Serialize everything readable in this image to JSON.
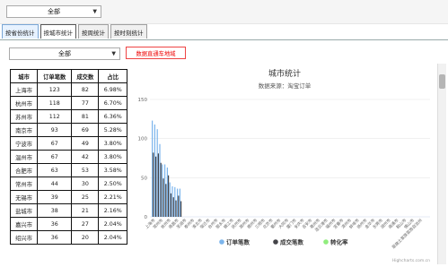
{
  "top_select": {
    "value": "全部"
  },
  "tabs": [
    {
      "label": "按省份统计",
      "state": "active"
    },
    {
      "label": "按城市统计",
      "state": "selected"
    },
    {
      "label": "按周统计",
      "state": "normal"
    },
    {
      "label": "按时刻统计",
      "state": "normal"
    }
  ],
  "sub_select": {
    "value": "全部"
  },
  "red_button": {
    "label": "数据直通车地域"
  },
  "table": {
    "headers": [
      "城市",
      "订单笔数",
      "成交数",
      "占比"
    ],
    "rows": [
      [
        "上海市",
        "123",
        "82",
        "6.98%"
      ],
      [
        "杭州市",
        "118",
        "77",
        "6.70%"
      ],
      [
        "苏州市",
        "112",
        "81",
        "6.36%"
      ],
      [
        "南京市",
        "93",
        "69",
        "5.28%"
      ],
      [
        "宁波市",
        "67",
        "49",
        "3.80%"
      ],
      [
        "温州市",
        "67",
        "42",
        "3.80%"
      ],
      [
        "合肥市",
        "63",
        "53",
        "3.58%"
      ],
      [
        "常州市",
        "44",
        "30",
        "2.50%"
      ],
      [
        "无锡市",
        "39",
        "25",
        "2.21%"
      ],
      [
        "盐城市",
        "38",
        "21",
        "2.16%"
      ],
      [
        "嘉兴市",
        "36",
        "27",
        "2.04%"
      ],
      [
        "绍兴市",
        "36",
        "20",
        "2.04%"
      ]
    ]
  },
  "chart_data": {
    "type": "bar",
    "title": "城市统计",
    "subtitle": "数据来源：淘宝订单",
    "ylim": [
      0,
      150
    ],
    "yticks": [
      0,
      50,
      100,
      150
    ],
    "grid": true,
    "legend_position": "bottom",
    "categories": [
      "上海市",
      "杭州市",
      "苏州市",
      "南京市",
      "宁波市",
      "温州市",
      "合肥市",
      "常州市",
      "无锡市",
      "盐城市",
      "嘉兴市",
      "绍兴市"
    ],
    "x_tick_labels": [
      "上海市",
      "常州市",
      "徐州市",
      "南昌市",
      "芜湖市",
      "泰州市",
      "淮北市",
      "宿迁市",
      "台州市",
      "丽水市",
      "镇江市",
      "抚州市",
      "滁州市",
      "德州市",
      "三明市",
      "北京市",
      "衢州市",
      "大同市",
      "厦门市",
      "安庆市",
      "吉安市",
      "亳州市",
      "连云港市",
      "福州市",
      "宜春市",
      "漳州市",
      "蚌埠市",
      "扬州市",
      "金华市",
      "东莞市",
      "湖州市",
      "南通市",
      "鞍山市",
      "佛山市",
      "恩施土家族苗族自治州"
    ],
    "series": [
      {
        "name": "订单笔数",
        "color": "#7cb5ec",
        "values": [
          123,
          118,
          112,
          93,
          67,
          67,
          63,
          44,
          39,
          38,
          36,
          36
        ]
      },
      {
        "name": "成交笔数",
        "color": "#434348",
        "values": [
          82,
          77,
          81,
          69,
          49,
          42,
          53,
          30,
          25,
          21,
          27,
          20
        ]
      },
      {
        "name": "转化率",
        "color": "#90ed7d",
        "values": []
      }
    ],
    "credits": "Highcharts.com.cn"
  }
}
